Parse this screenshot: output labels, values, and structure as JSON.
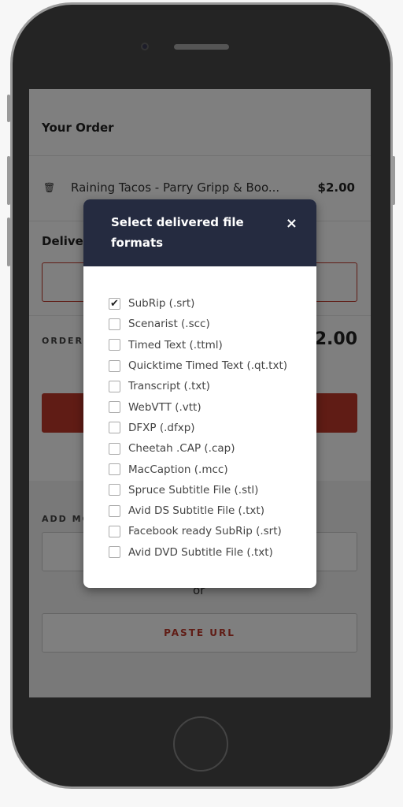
{
  "order": {
    "title": "Your Order",
    "item_name": "Raining Tacos - Parry Gripp & Boo...",
    "item_price": "$2.00",
    "delivered_label_partial": "Delive",
    "order_total_label_partial": "ORDER",
    "order_total_partial": "2.00"
  },
  "add_more": {
    "label_partial": "ADD MO",
    "or_text": "or",
    "paste_url_label": "PASTE URL"
  },
  "modal": {
    "title": "Select delivered file formats",
    "close_icon": "×",
    "options": [
      {
        "label": "SubRip (.srt)",
        "checked": true
      },
      {
        "label": "Scenarist (.scc)",
        "checked": false
      },
      {
        "label": "Timed Text (.ttml)",
        "checked": false
      },
      {
        "label": "Quicktime Timed Text (.qt.txt)",
        "checked": false
      },
      {
        "label": "Transcript (.txt)",
        "checked": false
      },
      {
        "label": "WebVTT (.vtt)",
        "checked": false
      },
      {
        "label": "DFXP (.dfxp)",
        "checked": false
      },
      {
        "label": "Cheetah .CAP (.cap)",
        "checked": false
      },
      {
        "label": "MacCaption (.mcc)",
        "checked": false
      },
      {
        "label": "Spruce Subtitle File (.stl)",
        "checked": false
      },
      {
        "label": "Avid DS Subtitle File (.txt)",
        "checked": false
      },
      {
        "label": "Facebook ready SubRip (.srt)",
        "checked": false
      },
      {
        "label": "Avid DVD Subtitle File (.txt)",
        "checked": false
      }
    ]
  },
  "colors": {
    "accent": "#c0392b",
    "modal_header": "#252b40"
  }
}
